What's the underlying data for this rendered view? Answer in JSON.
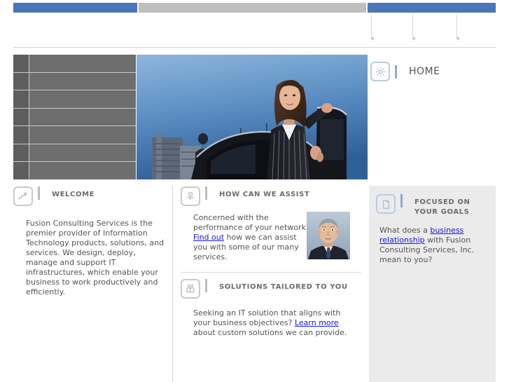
{
  "site": {
    "page_title": "HOME"
  },
  "topnav": {
    "bars": [
      {
        "name": "primary-nav-bar-left",
        "color": "#4a77b8"
      },
      {
        "name": "primary-nav-bar-middle",
        "color": "#bfbfbf"
      },
      {
        "name": "primary-nav-bar-right",
        "color": "#4a77b8"
      }
    ],
    "dividers": 3
  },
  "hero": {
    "grid_rows": 7,
    "photo_alt": "businesswoman-stepping-out-of-car"
  },
  "header": {
    "icon": "gear-icon",
    "title": "HOME"
  },
  "sections": {
    "welcome": {
      "icon": "stairs-chart-icon",
      "title": "WELCOME",
      "body": "Fusion Consulting Services is the premier provider of Information Technology products, solutions, and services. We design, deploy, manage and support IT infrastructures, which enable your business to work productively and efficiently."
    },
    "assist": {
      "icon": "person-target-icon",
      "title": "HOW CAN WE ASSIST",
      "body_before": "Concerned with the performance of your network? ",
      "link": "Find out",
      "body_after": " how we can assist you with some of our many services.",
      "photo_alt": "businessman-headshot"
    },
    "solutions": {
      "icon": "two-people-icon",
      "title": "SOLUTIONS TAILORED TO YOU",
      "body_before": "Seeking an IT solution that aligns with your business objectives? ",
      "link": "Learn more",
      "body_after": " about custom solutions we can provide."
    },
    "goals": {
      "icon": "document-page-icon",
      "title": "FOCUSED ON YOUR GOALS",
      "body_before": "What does a ",
      "link": "business relationship",
      "body_after": " with Fusion Consulting Services, Inc. mean to you?"
    }
  },
  "colors": {
    "accent_blue": "#4a77b8",
    "link_blue": "#1414ee",
    "panel_gray": "#ebebeb",
    "grid_gray": "#6e6e6e",
    "text_gray": "#555555"
  }
}
